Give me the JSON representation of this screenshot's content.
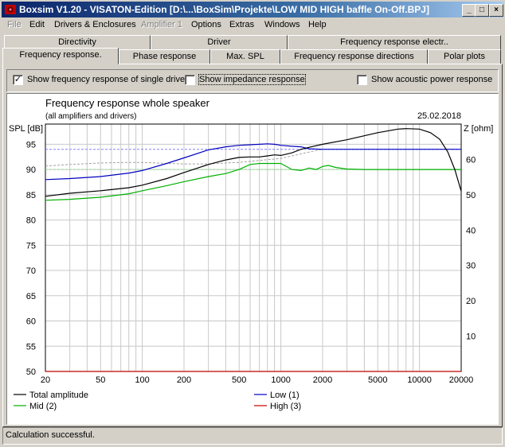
{
  "window": {
    "title": "Boxsim V1.20 - VISATON-Edition [D:\\...\\BoxSim\\Projekte\\LOW MID HIGH baffle On-Off.BPJ]",
    "buttons": {
      "minimize": "_",
      "maximize": "□",
      "close": "×"
    }
  },
  "menu": [
    {
      "label": "File",
      "enabled": false
    },
    {
      "label": "Edit",
      "enabled": true
    },
    {
      "label": "Drivers & Enclosures",
      "enabled": true
    },
    {
      "label": "Amplifier 1",
      "enabled": false
    },
    {
      "label": "Options",
      "enabled": true
    },
    {
      "label": "Extras",
      "enabled": true
    },
    {
      "label": "Windows",
      "enabled": true
    },
    {
      "label": "Help",
      "enabled": true
    }
  ],
  "tabs_row1": [
    "Directivity",
    "Driver",
    "Frequency response electr.."
  ],
  "tabs_row2": [
    "Frequency response.",
    "Phase response",
    "Max. SPL",
    "Frequency response directions",
    "Polar plots"
  ],
  "active_tab": "Frequency response.",
  "options": {
    "single_drive": {
      "label": "Show frequency response of single drive",
      "checked": true
    },
    "impedance": {
      "label": "Show impedance response",
      "checked": false
    },
    "acoustic_power": {
      "label": "Show acoustic power response",
      "checked": false
    }
  },
  "status": "Calculation successful.",
  "icons": {
    "app": "speaker-app-icon",
    "check": "✓"
  },
  "chart_data": {
    "type": "line",
    "title": "Frequency response whole speaker",
    "subtitle": "(all amplifiers and drivers)",
    "date": "25.02.2018",
    "ylabel": "SPL [dB]",
    "y2label": "Z [ohm]",
    "xscale": "log",
    "xlim": [
      20,
      20000
    ],
    "ylim": [
      50,
      99
    ],
    "y2lim": [
      0,
      70
    ],
    "xticks": [
      {
        "v": 20,
        "t": "20"
      },
      {
        "v": 50,
        "t": "50"
      },
      {
        "v": 100,
        "t": "100"
      },
      {
        "v": 200,
        "t": "200"
      },
      {
        "v": 500,
        "t": "500"
      },
      {
        "v": 1000,
        "t": "1000"
      },
      {
        "v": 2000,
        "t": "2000"
      },
      {
        "v": 5000,
        "t": "5000"
      },
      {
        "v": 10000,
        "t": "10000"
      },
      {
        "v": 20000,
        "t": "20000"
      }
    ],
    "yticks": [
      50,
      55,
      60,
      65,
      70,
      75,
      80,
      85,
      90,
      95
    ],
    "y2ticks": [
      10,
      20,
      30,
      40,
      50,
      60
    ],
    "grid": true,
    "series": [
      {
        "name": "Total amplitude",
        "color": "#000000",
        "x": [
          20,
          30,
          50,
          80,
          100,
          150,
          200,
          300,
          400,
          500,
          600,
          700,
          800,
          900,
          1000,
          1200,
          1400,
          1600,
          2000,
          3000,
          5000,
          7000,
          8000,
          10000,
          12000,
          14000,
          16000,
          18000,
          20000
        ],
        "y": [
          84.7,
          85.3,
          85.8,
          86.4,
          86.9,
          88.2,
          89.4,
          91.0,
          91.9,
          92.4,
          92.5,
          92.5,
          92.7,
          92.9,
          92.8,
          93.3,
          94.0,
          94.4,
          95.0,
          95.9,
          97.3,
          98.0,
          98.1,
          98.0,
          97.3,
          96.0,
          93.5,
          90.0,
          85.7
        ]
      },
      {
        "name": "Low (1)",
        "color": "#0000c0",
        "x": [
          20,
          30,
          50,
          80,
          100,
          150,
          200,
          300,
          400,
          500,
          600,
          700,
          800,
          900,
          1000,
          1200,
          1400,
          1600,
          2000,
          5000,
          20000
        ],
        "y": [
          88.0,
          88.2,
          88.6,
          89.3,
          89.8,
          91.2,
          92.3,
          93.9,
          94.5,
          94.8,
          94.9,
          95.0,
          95.1,
          95.0,
          94.8,
          94.6,
          94.5,
          94.1,
          94.0,
          94.0,
          94.0
        ]
      },
      {
        "name": "Mid (2)",
        "color": "#00b000",
        "x": [
          20,
          30,
          50,
          80,
          100,
          150,
          200,
          300,
          400,
          500,
          600,
          700,
          800,
          900,
          1000,
          1200,
          1400,
          1600,
          1800,
          2000,
          2200,
          2500,
          3000,
          4000,
          5000,
          7000,
          10000,
          14000,
          16000,
          18000,
          20000
        ],
        "y": [
          83.9,
          84.1,
          84.5,
          85.2,
          85.8,
          86.8,
          87.6,
          88.6,
          89.2,
          90.0,
          91.0,
          91.2,
          91.2,
          91.2,
          91.2,
          90.0,
          89.8,
          90.3,
          90.0,
          90.6,
          90.8,
          90.4,
          90.1,
          90.0,
          90.0,
          90.0,
          90.0,
          90.0,
          90.0,
          90.0,
          90.0
        ]
      },
      {
        "name": "High (3)",
        "color": "#c00000",
        "x": [
          20,
          20000
        ],
        "y": [
          50,
          50
        ]
      }
    ],
    "dashed_series": [
      {
        "color": "#8080ff",
        "x": [
          20,
          20000
        ],
        "y": [
          94.0,
          94.0
        ]
      },
      {
        "color": "#90e090",
        "x": [
          20,
          20000
        ],
        "y": [
          90.0,
          90.0
        ]
      },
      {
        "color": "#a0a0a0",
        "x": [
          20,
          30,
          50,
          80,
          100,
          150,
          200,
          300,
          400,
          500,
          700,
          1000,
          1500,
          2000
        ],
        "y": [
          90.7,
          91.0,
          91.3,
          91.4,
          91.4,
          91.2,
          91.1,
          91.1,
          91.3,
          91.4,
          91.8,
          92.2,
          93.3,
          94.0
        ]
      }
    ],
    "legend": [
      "Total amplitude",
      "Low (1)",
      "Mid (2)",
      "High (3)"
    ]
  }
}
